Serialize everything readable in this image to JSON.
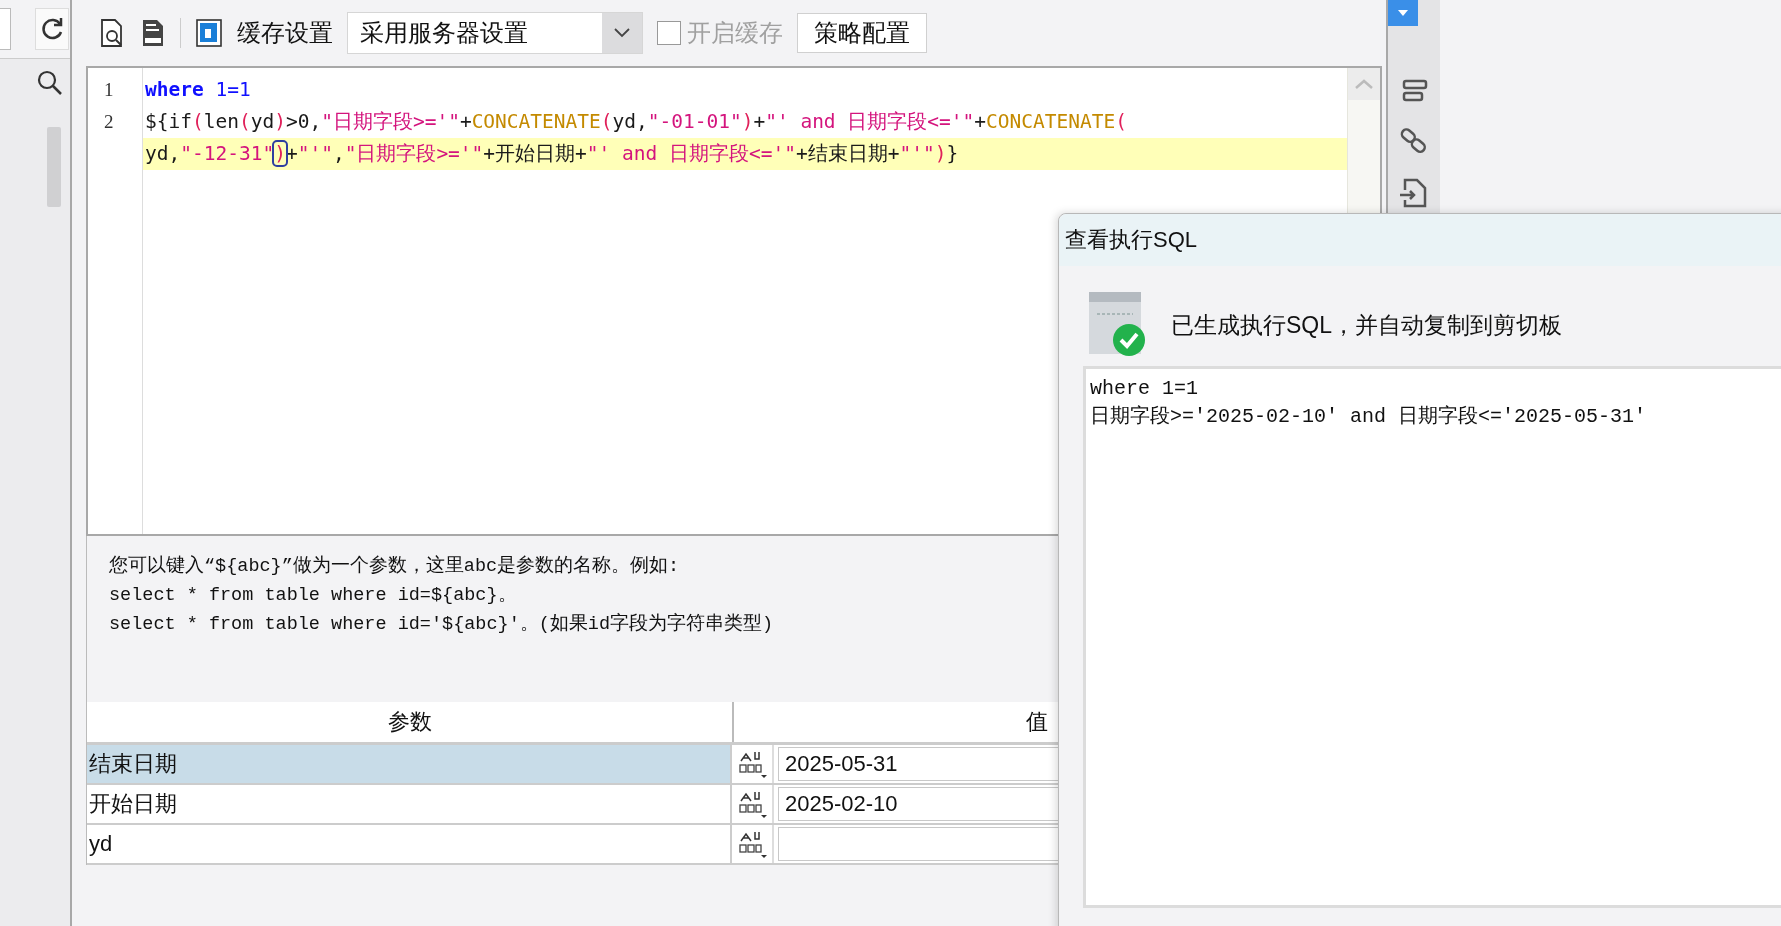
{
  "toolbar": {
    "cache_label": "缓存设置",
    "cache_mode": "采用服务器设置",
    "enable_cache": {
      "label": "开启缓存",
      "checked": false,
      "disabled": true
    },
    "strategy_button": "策略配置"
  },
  "editor": {
    "lines": [
      {
        "number": "1",
        "rows": [
          {
            "highlighted": false,
            "tokens": [
              {
                "kind": "keyword",
                "text": "where"
              },
              {
                "kind": "number",
                "text": "1=1",
                "spaced": true
              }
            ]
          }
        ]
      },
      {
        "number": "2",
        "rows": [
          {
            "highlighted": false,
            "tokens": [
              {
                "kind": "text",
                "text": "${if"
              },
              {
                "kind": "paren",
                "text": "("
              },
              {
                "kind": "text",
                "text": "len"
              },
              {
                "kind": "paren",
                "text": "("
              },
              {
                "kind": "text",
                "text": "yd"
              },
              {
                "kind": "paren",
                "text": ")"
              },
              {
                "kind": "text",
                "text": ">0,"
              },
              {
                "kind": "string",
                "text": "\"日期字段>='\""
              },
              {
                "kind": "text",
                "text": "+"
              },
              {
                "kind": "func",
                "text": "CONCATENATE"
              },
              {
                "kind": "paren",
                "text": "("
              },
              {
                "kind": "text",
                "text": "yd,"
              },
              {
                "kind": "string",
                "text": "\"-01-01\""
              },
              {
                "kind": "paren",
                "text": ")"
              },
              {
                "kind": "text",
                "text": "+"
              },
              {
                "kind": "string",
                "text": "\"' and 日期字段<='\""
              },
              {
                "kind": "text",
                "text": "+"
              },
              {
                "kind": "func",
                "text": "CONCATENATE"
              },
              {
                "kind": "paren",
                "text": "("
              }
            ]
          },
          {
            "highlighted": true,
            "tokens": [
              {
                "kind": "text",
                "text": "yd,"
              },
              {
                "kind": "string",
                "text": "\"-12-31\""
              },
              {
                "kind": "paren",
                "text": ")",
                "matched": true
              },
              {
                "kind": "text",
                "text": "+"
              },
              {
                "kind": "string",
                "text": "\"'\""
              },
              {
                "kind": "text",
                "text": ","
              },
              {
                "kind": "string",
                "text": "\"日期字段>='\""
              },
              {
                "kind": "text",
                "text": "+开始日期+"
              },
              {
                "kind": "string",
                "text": "\"' and 日期字段<='\""
              },
              {
                "kind": "text",
                "text": "+结束日期+"
              },
              {
                "kind": "string",
                "text": "\"'\""
              },
              {
                "kind": "paren",
                "text": ")"
              },
              {
                "kind": "text",
                "text": "}"
              }
            ]
          }
        ]
      }
    ]
  },
  "help": {
    "lines": [
      "您可以键入“${abc}”做为一个参数，这里abc是参数的名称。例如:",
      "select * from table where id=${abc}。",
      "select * from table where id='${abc}'。(如果id字段为字符串类型)"
    ]
  },
  "params_table": {
    "columns": [
      "参数",
      "值"
    ],
    "rows": [
      {
        "name": "结束日期",
        "value": "2025-05-31",
        "selected": true
      },
      {
        "name": "开始日期",
        "value": "2025-02-10",
        "selected": false
      },
      {
        "name": "yd",
        "selected": false
      }
    ]
  },
  "dialog": {
    "title": "查看执行SQL",
    "message": "已生成执行SQL，并自动复制到剪切板",
    "result_lines": [
      "where 1=1",
      "日期字段>='2025-02-10' and 日期字段<='2025-05-31'"
    ]
  }
}
